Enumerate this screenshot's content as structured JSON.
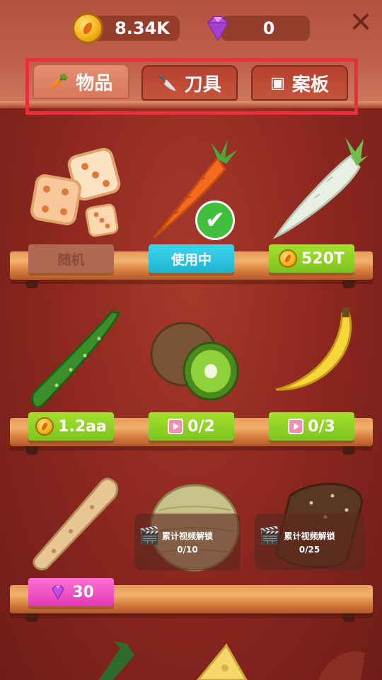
{
  "currency": {
    "coins": "8.34K",
    "gems": "0"
  },
  "tabs": [
    {
      "label": "物品",
      "icon": "carrot-icon",
      "active": true
    },
    {
      "label": "刀具",
      "icon": "knife-icon",
      "active": false
    },
    {
      "label": "案板",
      "icon": "board-icon",
      "active": false
    }
  ],
  "items": [
    {
      "name": "dice",
      "button": "随机",
      "state": "random"
    },
    {
      "name": "carrot",
      "button": "使用中",
      "state": "in-use"
    },
    {
      "name": "daikon",
      "button": "520T",
      "state": "coin-price"
    },
    {
      "name": "cucumber",
      "button": "1.2aa",
      "state": "coin-price"
    },
    {
      "name": "kiwi",
      "button": "0/2",
      "state": "video"
    },
    {
      "name": "banana",
      "button": "0/3",
      "state": "video"
    },
    {
      "name": "breadstick",
      "button": "30",
      "state": "gem-price"
    },
    {
      "name": "melon",
      "lock_title": "累计视频解锁",
      "lock_progress": "0/10",
      "state": "locked"
    },
    {
      "name": "bread",
      "lock_title": "累计视频解锁",
      "lock_progress": "0/25",
      "state": "locked"
    }
  ],
  "colors": {
    "background": "#8e2a22",
    "highlight": "#e8303a",
    "in_use": "#1fb5d3",
    "price_green": "#7cc520",
    "price_pink": "#e13ab6"
  }
}
